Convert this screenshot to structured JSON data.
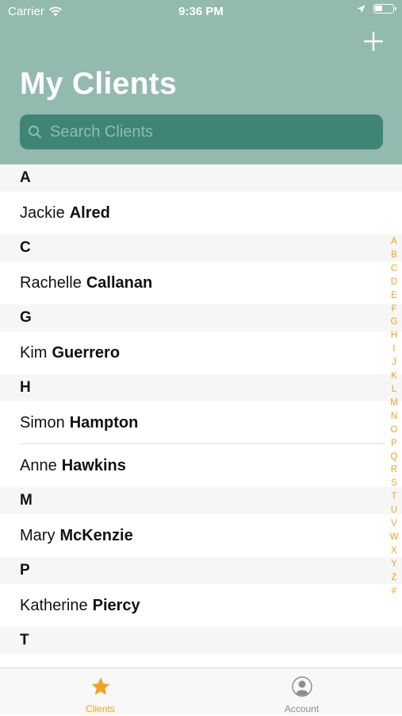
{
  "status_bar": {
    "carrier": "Carrier",
    "time": "9:36 PM"
  },
  "header": {
    "title": "My Clients",
    "add_icon": "plus-icon"
  },
  "search": {
    "placeholder": "Search Clients",
    "value": ""
  },
  "sections": [
    {
      "letter": "A",
      "clients": [
        {
          "first": "Jackie",
          "last": "Alred"
        }
      ]
    },
    {
      "letter": "C",
      "clients": [
        {
          "first": "Rachelle",
          "last": "Callanan"
        }
      ]
    },
    {
      "letter": "G",
      "clients": [
        {
          "first": "Kim",
          "last": "Guerrero"
        }
      ]
    },
    {
      "letter": "H",
      "clients": [
        {
          "first": "Simon",
          "last": "Hampton"
        },
        {
          "first": "Anne",
          "last": "Hawkins"
        }
      ]
    },
    {
      "letter": "M",
      "clients": [
        {
          "first": "Mary",
          "last": "McKenzie"
        }
      ]
    },
    {
      "letter": "P",
      "clients": [
        {
          "first": "Katherine",
          "last": "Piercy"
        }
      ]
    },
    {
      "letter": "T",
      "clients": []
    }
  ],
  "index_letters": [
    "A",
    "B",
    "C",
    "D",
    "E",
    "F",
    "G",
    "H",
    "I",
    "J",
    "K",
    "L",
    "M",
    "N",
    "O",
    "P",
    "Q",
    "R",
    "S",
    "T",
    "U",
    "V",
    "W",
    "X",
    "Y",
    "Z",
    "#"
  ],
  "tab_bar": {
    "tabs": [
      {
        "label": "Clients",
        "icon": "star-icon",
        "active": true
      },
      {
        "label": "Account",
        "icon": "person-icon",
        "active": false
      }
    ]
  },
  "colors": {
    "header_bg": "#93baae",
    "search_bg": "#3f8575",
    "accent": "#f4a21f",
    "inactive_tab": "#8e8e8e"
  }
}
